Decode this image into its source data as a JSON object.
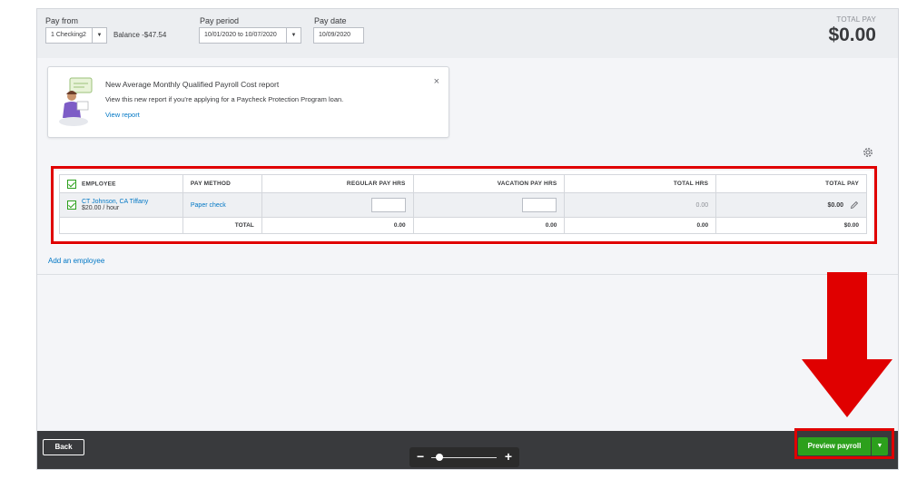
{
  "header": {
    "pay_from_label": "Pay from",
    "pay_from_value": "1 Checking2",
    "balance": "Balance -$47.54",
    "pay_period_label": "Pay period",
    "pay_period_value": "10/01/2020 to 10/07/2020",
    "pay_date_label": "Pay date",
    "pay_date_value": "10/09/2020",
    "total_pay_label": "TOTAL PAY",
    "total_pay_value": "$0.00"
  },
  "promo": {
    "title": "New Average Monthly Qualified Payroll Cost report",
    "body": "View this new report if you're applying for a Paycheck Protection Program loan.",
    "link": "View report",
    "close": "×"
  },
  "table": {
    "headers": {
      "employee": "EMPLOYEE",
      "pay_method": "PAY METHOD",
      "regular": "REGULAR PAY HRS",
      "vacation": "VACATION PAY HRS",
      "total_hrs": "TOTAL HRS",
      "total_pay": "TOTAL PAY"
    },
    "row": {
      "name": "CT Johnson, CA Tiffany",
      "rate": "$20.00 / hour",
      "pay_method": "Paper check",
      "total_hrs": "0.00",
      "total_pay": "$0.00"
    },
    "totals": {
      "label": "TOTAL",
      "regular": "0.00",
      "vacation": "0.00",
      "total_hrs": "0.00",
      "total_pay": "$0.00"
    }
  },
  "add_employee": "Add an employee",
  "footer": {
    "back": "Back",
    "preview": "Preview payroll",
    "caret": "▼"
  },
  "zoom": {
    "minus": "−",
    "plus": "+",
    "level": 0.08
  },
  "colors": {
    "accent_green": "#2ca01c",
    "link_blue": "#0077c5",
    "annotation_red": "#e00000",
    "footer_dark": "#393a3d"
  }
}
